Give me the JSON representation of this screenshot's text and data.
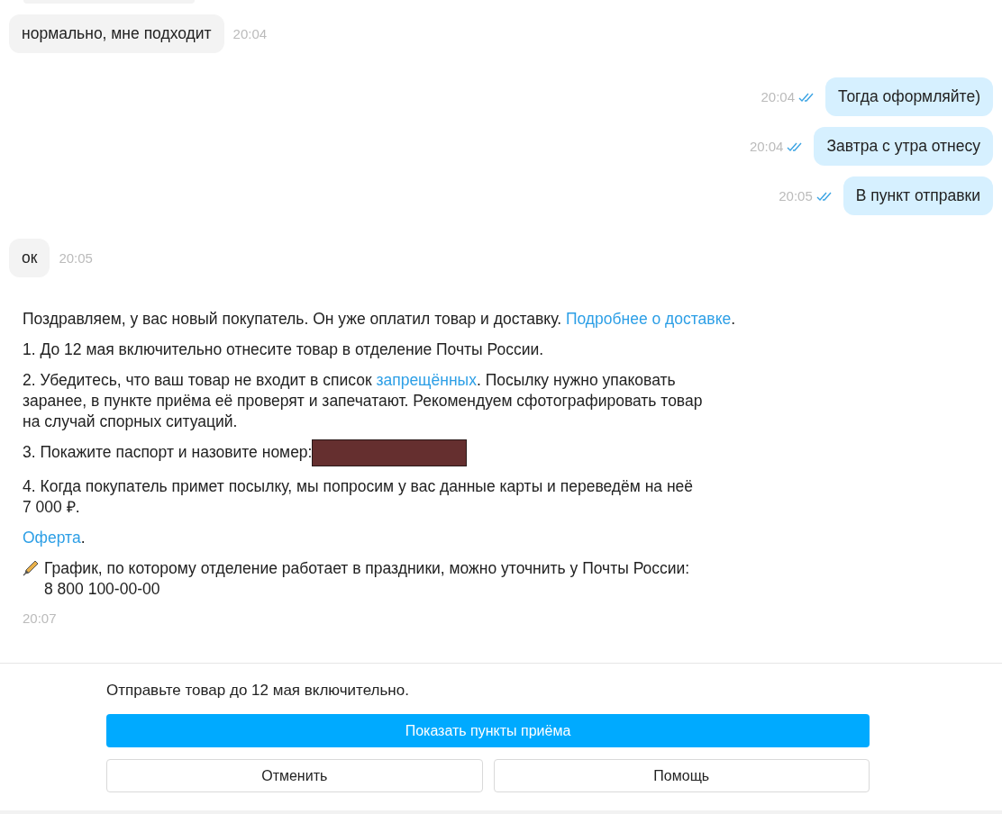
{
  "messages": [
    {
      "kind": "incoming",
      "text": "нормально, мне подходит",
      "time": "20:04"
    },
    {
      "kind": "outgoing",
      "text": "Тогда оформляйте)",
      "time": "20:04",
      "read": true
    },
    {
      "kind": "outgoing",
      "text": "Завтра с утра отнесу",
      "time": "20:04",
      "read": true
    },
    {
      "kind": "outgoing",
      "text": "В пункт отправки",
      "time": "20:05",
      "read": true
    },
    {
      "kind": "incoming",
      "text": "ок",
      "time": "20:05"
    }
  ],
  "system_message": {
    "paragraphs": [
      {
        "kind": "text",
        "lines": [
          [
            {
              "kind": "text",
              "t": "Поздравляем, у вас новый покупатель. Он уже оплатил товар и доставку. "
            },
            {
              "kind": "link",
              "t": "Подробнее о доставке"
            },
            {
              "kind": "text",
              "t": "."
            }
          ]
        ]
      },
      {
        "kind": "text",
        "lines": [
          [
            {
              "kind": "text",
              "t": "1. До 12 мая включительно отнесите товар в отделение Почты России."
            }
          ]
        ]
      },
      {
        "kind": "text",
        "lines": [
          [
            {
              "kind": "text",
              "t": "2. Убедитесь, что ваш товар не входит в список "
            },
            {
              "kind": "link",
              "t": "запрещённых"
            },
            {
              "kind": "text",
              "t": ". Посылку нужно упаковать"
            }
          ],
          [
            {
              "kind": "text",
              "t": "заранее, в пункте приёма её проверят и запечатают. Рекомендуем сфотографировать товар"
            }
          ],
          [
            {
              "kind": "text",
              "t": "на случай спорных ситуаций."
            }
          ]
        ]
      },
      {
        "kind": "text",
        "redacted": true,
        "lines": [
          [
            {
              "kind": "text",
              "t": "3. Покажите паспорт и назовите номер:"
            }
          ]
        ]
      },
      {
        "kind": "text",
        "lines": [
          [
            {
              "kind": "text",
              "t": "4. Когда покупатель примет посылку, мы попросим у вас данные карты и переведём на неё"
            }
          ],
          [
            {
              "kind": "text",
              "t": "7 000 ₽."
            }
          ]
        ]
      },
      {
        "kind": "text",
        "lines": [
          [
            {
              "kind": "link",
              "t": "Оферта"
            },
            {
              "kind": "text",
              "t": "."
            }
          ]
        ]
      },
      {
        "kind": "note",
        "lines": [
          [
            {
              "kind": "text",
              "t": "График, по которому отделение работает в праздники, можно уточнить у Почты России:"
            }
          ],
          [
            {
              "kind": "text",
              "t": "8 800 100-00-00"
            }
          ]
        ]
      }
    ],
    "time": "20:07"
  },
  "footer": {
    "text": "Отправьте товар до 12 мая включительно.",
    "primary_button": "Показать пункты приёма",
    "buttons": [
      "Отменить",
      "Помощь"
    ]
  }
}
